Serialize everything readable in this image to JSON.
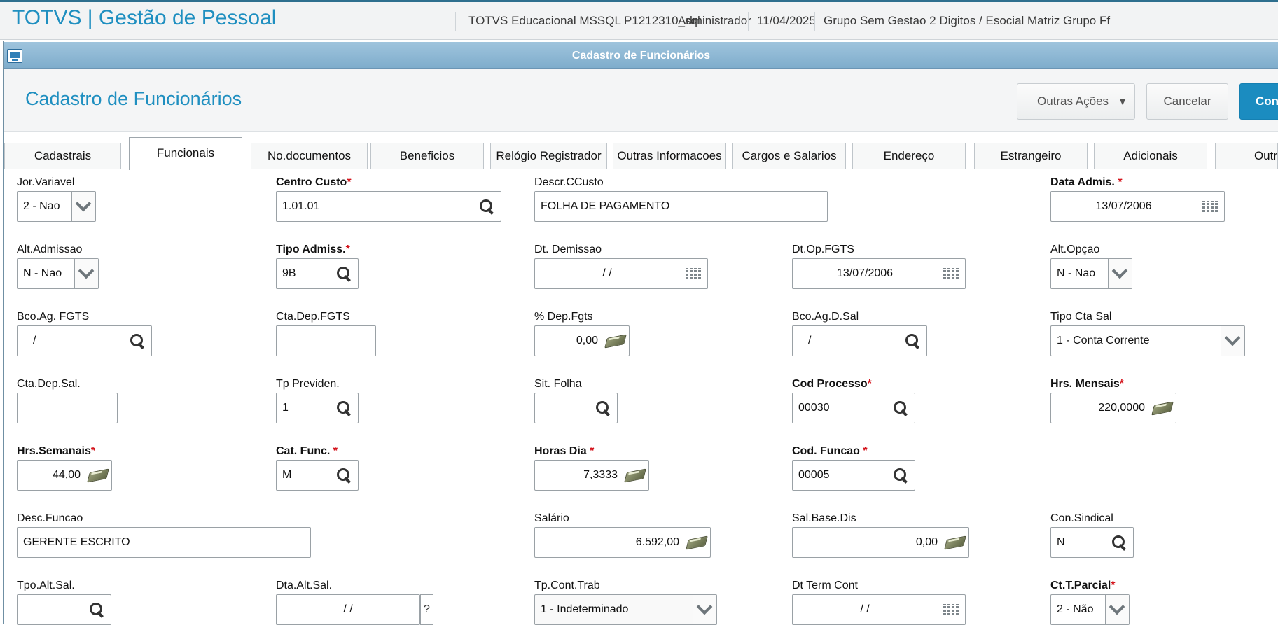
{
  "app": {
    "title": "TOTVS | Gestão de Pessoal",
    "environment": "TOTVS Educacional MSSQL P1212310_sql",
    "user": "Administrador",
    "date": "11/04/2025",
    "company": "Grupo Sem Gestao 2 Digitos / Esocial Matriz Grupo Ff"
  },
  "window": {
    "title": "Cadastro de Funcionários"
  },
  "header": {
    "page_title": "Cadastro de Funcionários",
    "other_actions_label": "Outras Ações",
    "cancel_label": "Cancelar",
    "confirm_label": "Con"
  },
  "tabs": [
    {
      "label": "Cadastrais",
      "active": false
    },
    {
      "label": "Funcionais",
      "active": true
    },
    {
      "label": "No.documentos",
      "active": false
    },
    {
      "label": "Beneficios",
      "active": false
    },
    {
      "label": "Relógio Registrador",
      "active": false
    },
    {
      "label": "Outras Informacoes",
      "active": false
    },
    {
      "label": "Cargos e Salarios",
      "active": false
    },
    {
      "label": "Endereço",
      "active": false
    },
    {
      "label": "Estrangeiro",
      "active": false
    },
    {
      "label": "Adicionais",
      "active": false
    },
    {
      "label": "Outr",
      "active": false
    }
  ],
  "form": {
    "jor_variavel": {
      "label": "Jor.Variavel",
      "value": "2 - Nao"
    },
    "centro_custo": {
      "label": "Centro Custo",
      "value": "1.01.01"
    },
    "descr_ccusto": {
      "label": "Descr.CCusto",
      "value": "FOLHA DE PAGAMENTO"
    },
    "data_admis": {
      "label": "Data Admis. ",
      "value": "13/07/2006"
    },
    "alt_admissao": {
      "label": "Alt.Admissao",
      "value": "N - Nao"
    },
    "tipo_admiss": {
      "label": "Tipo Admiss.",
      "value": "9B"
    },
    "dt_demissao": {
      "label": "Dt. Demissao",
      "value": "/  /"
    },
    "dt_op_fgts": {
      "label": "Dt.Op.FGTS",
      "value": "13/07/2006"
    },
    "alt_opcao": {
      "label": "Alt.Opçao",
      "value": "N - Nao"
    },
    "bco_ag_fgts": {
      "label": "Bco.Ag. FGTS",
      "value": "/"
    },
    "cta_dep_fgts": {
      "label": "Cta.Dep.FGTS",
      "value": ""
    },
    "pct_dep_fgts": {
      "label": "% Dep.Fgts",
      "value": "0,00"
    },
    "bco_ag_d_sal": {
      "label": "Bco.Ag.D.Sal",
      "value": "/"
    },
    "tipo_cta_sal": {
      "label": "Tipo Cta Sal",
      "value": "1 - Conta Corrente"
    },
    "cta_dep_sal": {
      "label": "Cta.Dep.Sal.",
      "value": ""
    },
    "tp_previden": {
      "label": "Tp Previden.",
      "value": "1"
    },
    "sit_folha": {
      "label": "Sit. Folha",
      "value": ""
    },
    "cod_processo": {
      "label": "Cod Processo",
      "value": "00030"
    },
    "hrs_mensais": {
      "label": "Hrs. Mensais",
      "value": "220,0000"
    },
    "hrs_semanais": {
      "label": "Hrs.Semanais",
      "value": "44,00"
    },
    "cat_func": {
      "label": "Cat. Func. ",
      "value": "M"
    },
    "horas_dia": {
      "label": "Horas Dia ",
      "value": "7,3333"
    },
    "cod_funcao": {
      "label": "Cod. Funcao ",
      "value": "00005"
    },
    "desc_funcao": {
      "label": "Desc.Funcao",
      "value": "GERENTE ESCRITO"
    },
    "salario": {
      "label": "Salário",
      "value": "6.592,00"
    },
    "sal_base_dis": {
      "label": "Sal.Base.Dis",
      "value": "0,00"
    },
    "con_sindical": {
      "label": "Con.Sindical",
      "value": "N"
    },
    "tpo_alt_sal": {
      "label": "Tpo.Alt.Sal.",
      "value": ""
    },
    "dta_alt_sal": {
      "label": "Dta.Alt.Sal.",
      "value": "/  /",
      "help": "?"
    },
    "tp_cont_trab": {
      "label": "Tp.Cont.Trab",
      "value": "1 - Indeterminado"
    },
    "dt_term_cont": {
      "label": "Dt Term Cont",
      "value": "/  /"
    },
    "ct_t_parcial": {
      "label": "Ct.T.Parcial",
      "value": "2 - Não"
    },
    "required_mark": "*"
  },
  "colors": {
    "brand_blue": "#1f8fc0",
    "confirm_button": "#1b8cc0",
    "required_star": "#d4141c",
    "titlebar": "#8fb8d6"
  },
  "icons": {
    "lookup": "search-icon",
    "date": "calendar-icon",
    "numeric": "calculator-icon",
    "select": "chevron-down-icon",
    "window": "window-icon"
  }
}
